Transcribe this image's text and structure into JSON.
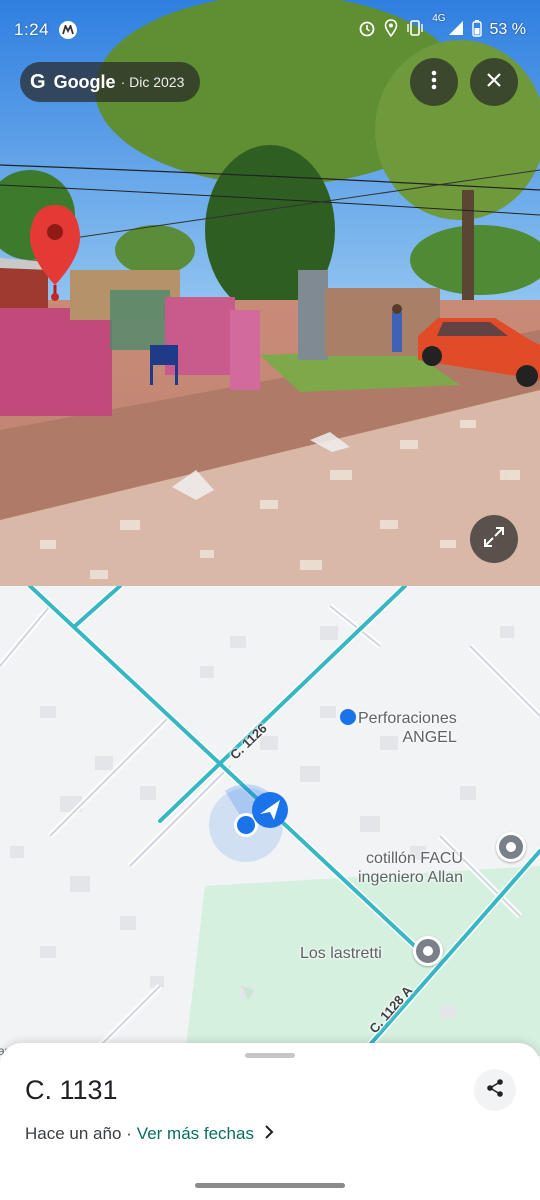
{
  "status_bar": {
    "time": "1:24",
    "network": "4G",
    "battery": "53 %",
    "icons": [
      "motorola-icon",
      "alarm-icon",
      "location-icon",
      "vibrate-icon",
      "signal-icon",
      "battery-icon"
    ]
  },
  "streetview": {
    "provider": "Google",
    "date": "· Dic 2023",
    "more_icon": "more-vert-icon",
    "close_icon": "close-icon",
    "expand_icon": "expand-icon"
  },
  "map": {
    "poi": [
      {
        "name": "Perforaciones\nANGEL"
      },
      {
        "name": "cotillón FACU\ningeniero Allan"
      },
      {
        "name": "Los lastretti"
      }
    ],
    "roads": [
      "C. 1126",
      "C. 1128 A"
    ],
    "edge_text": "arr"
  },
  "sheet": {
    "title": "C. 1131",
    "date_text": "Hace un año ·",
    "more_dates": "Ver más fechas",
    "share_icon": "share-icon"
  },
  "colors": {
    "road": "#37b7c3",
    "accent": "#1a73e8",
    "pin_red": "#e53935",
    "park": "#d6f0df",
    "link": "#0b6e5f"
  }
}
